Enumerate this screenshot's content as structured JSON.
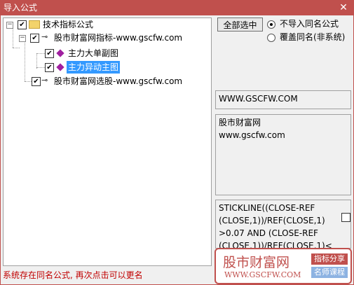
{
  "window": {
    "title": "导入公式",
    "close": "✕"
  },
  "tree": {
    "root": {
      "label": "技术指标公式",
      "expander": "−",
      "checked": "✔"
    },
    "n1": {
      "label": "股市财富网指标-www.gscfw.com",
      "expander": "−",
      "checked": "✔"
    },
    "n1a": {
      "label": "主力大单副图",
      "checked": "✔"
    },
    "n1b": {
      "label": "主力异动主图",
      "checked": "✔"
    },
    "n2": {
      "label": "股市财富网选股-www.gscfw.com",
      "checked": "✔"
    }
  },
  "toolbar": {
    "select_all": "全部选中"
  },
  "options": {
    "opt1": "不导入同名公式",
    "opt2": "覆盖同名(非系统)"
  },
  "info": {
    "url": "WWW.GSCFW.COM",
    "desc1": "股市财富网",
    "desc2": "www.gscfw.com",
    "code1": "STICKLINE((CLOSE-REF",
    "code2": "(CLOSE,1))/REF(CLOSE,1)",
    "code3": ">0.07 AND (CLOSE-REF",
    "code4": "(CLOSE,1))/REF(CLOSE,1)<"
  },
  "status": "系统存在同名公式, 再次点击可以更名",
  "logo": {
    "name": "股市财富网",
    "url": "WWW.GSCFW.COM",
    "tag1": "指标分享",
    "tag2": "名师课程",
    "tag1_color": "#c0504d",
    "tag2_color": "#8db3e2"
  }
}
